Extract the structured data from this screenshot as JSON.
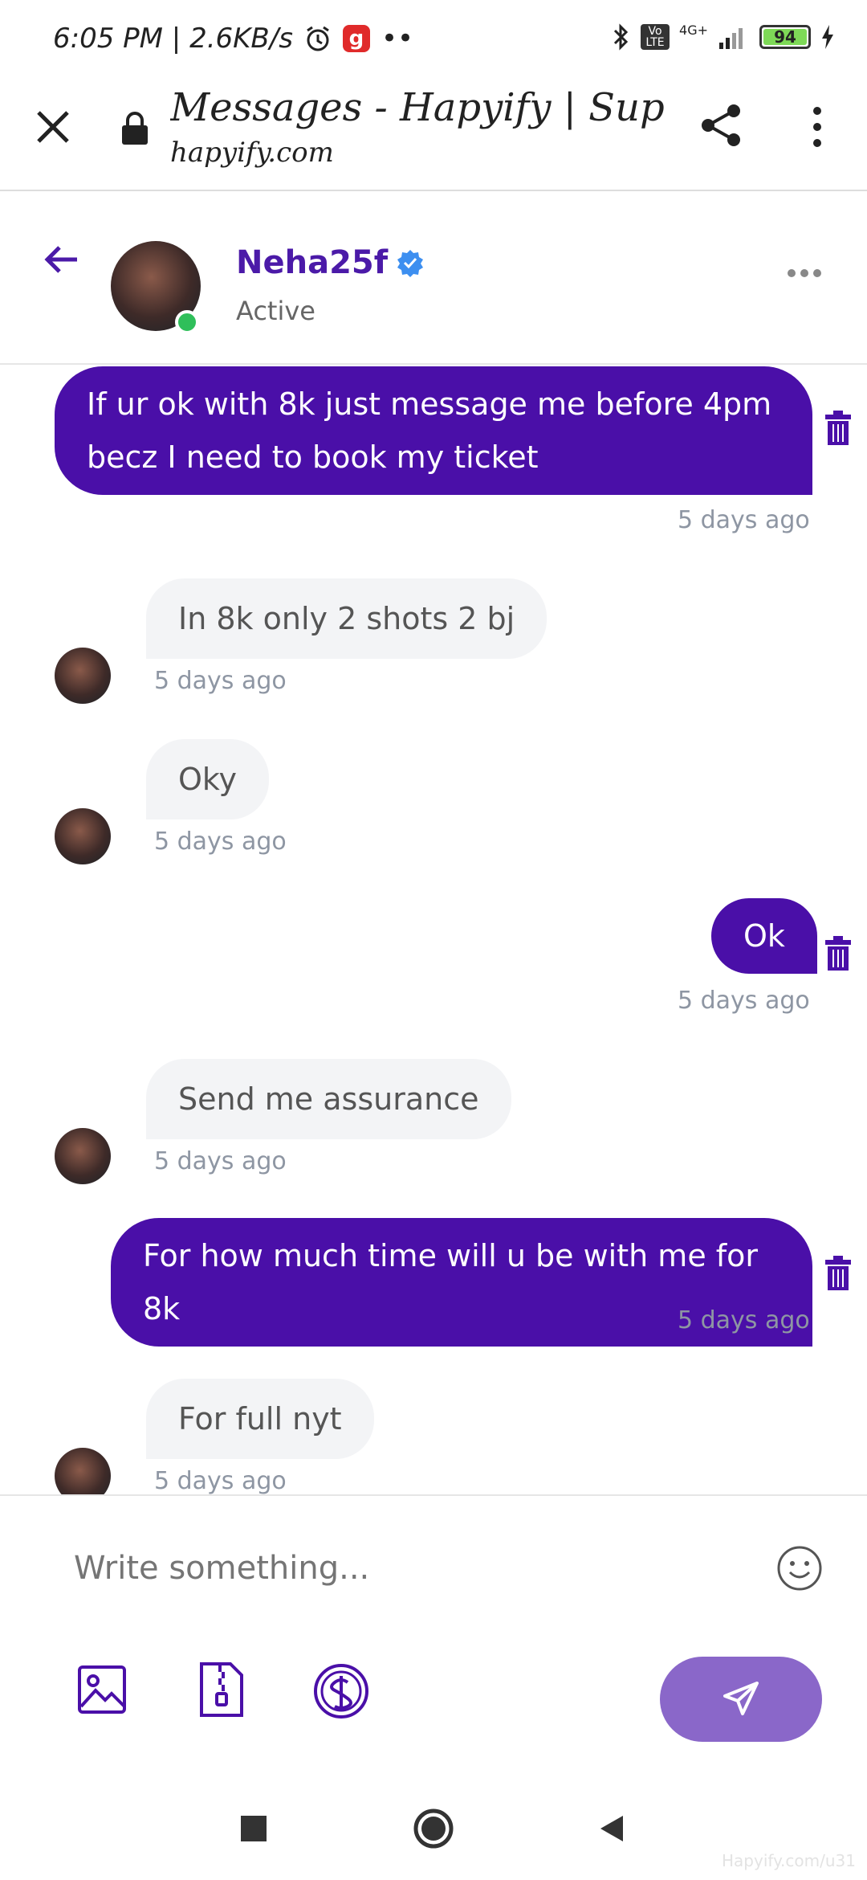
{
  "status_bar": {
    "time_speed": "6:05 PM | 2.6KB/s",
    "app_badge": "g",
    "network": "4G+",
    "volte": "Vo LTE",
    "battery": "94"
  },
  "browser": {
    "title": "Messages - Hapyify | Sup...",
    "url": "hapyify.com"
  },
  "chat": {
    "name": "Neha25f",
    "status": "Active"
  },
  "messages": [
    {
      "direction": "out",
      "text": "If ur ok with 8k just message me before 4pm becz I need to book my ticket",
      "time": "5 days ago"
    },
    {
      "direction": "in",
      "text": "In 8k only 2 shots 2 bj",
      "time": "5 days ago"
    },
    {
      "direction": "in",
      "text": "Oky",
      "time": "5 days ago"
    },
    {
      "direction": "out",
      "text": "Ok",
      "time": "5 days ago"
    },
    {
      "direction": "in",
      "text": "Send me assurance",
      "time": "5 days ago"
    },
    {
      "direction": "out",
      "text": "For how much time will u be with me for 8k",
      "time": "5 days ago"
    },
    {
      "direction": "in",
      "text": "For full nyt",
      "time": "5 days ago"
    }
  ],
  "composer": {
    "placeholder": "Write something..."
  },
  "watermark": "Hapyify.com/u31",
  "colors": {
    "brand_purple": "#4a0fa8",
    "send_button": "#8a67c9",
    "online": "#2fbf5a",
    "verified": "#3d8ff0"
  },
  "icons": [
    "close-icon",
    "lock-icon",
    "share-icon",
    "more-vert-icon",
    "back-arrow-icon",
    "verified-icon",
    "more-horiz-icon",
    "trash-icon",
    "emoji-icon",
    "image-icon",
    "zip-file-icon",
    "dollar-icon",
    "send-icon"
  ]
}
